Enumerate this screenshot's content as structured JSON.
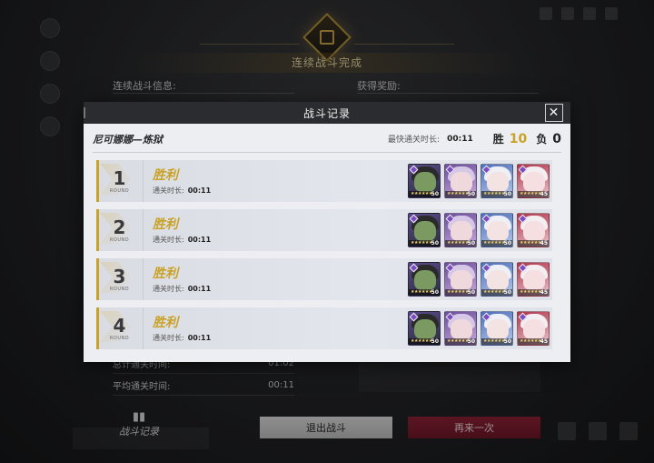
{
  "background": {
    "banner_title": "连续战斗完成",
    "left_section_label": "连续战斗信息:",
    "right_section_label": "获得奖励:",
    "stats": [
      {
        "label": "总计通关时间:",
        "value": "01:02"
      },
      {
        "label": "平均通关时间:",
        "value": "00:11"
      }
    ],
    "battle_log_label": "战斗记录",
    "exit_button": "退出战斗",
    "retry_button": "再来一次"
  },
  "modal": {
    "title": "战斗记录",
    "close_icon": "close-icon",
    "stage_name": "尼可娜娜—炼狱",
    "fastest_label": "最快通关时长:",
    "fastest_value": "00:11",
    "win_label": "胜",
    "win_count": "10",
    "lose_label": "负",
    "lose_count": "0",
    "round_word": "ROUND",
    "clear_time_label": "通关时长:",
    "rounds": [
      {
        "number": "1",
        "result": "胜利",
        "time": "00:11"
      },
      {
        "number": "2",
        "result": "胜利",
        "time": "00:11"
      },
      {
        "number": "3",
        "result": "胜利",
        "time": "00:11"
      },
      {
        "number": "4",
        "result": "胜利",
        "time": "00:11"
      }
    ],
    "team": [
      {
        "portrait": "dark-cap-character-portrait",
        "stars": "★★★★★★",
        "level": "50"
      },
      {
        "portrait": "lavender-hair-character-portrait",
        "stars": "★★★★★★",
        "level": "50"
      },
      {
        "portrait": "white-hair-blue-character-portrait",
        "stars": "★★★★★★",
        "level": "50"
      },
      {
        "portrait": "white-hair-red-character-portrait",
        "stars": "★★★★★★",
        "level": "45"
      }
    ],
    "colors": {
      "accent_gold": "#c9a227",
      "retry_red": "#8e2236",
      "header_dark": "#2b2c30"
    }
  }
}
